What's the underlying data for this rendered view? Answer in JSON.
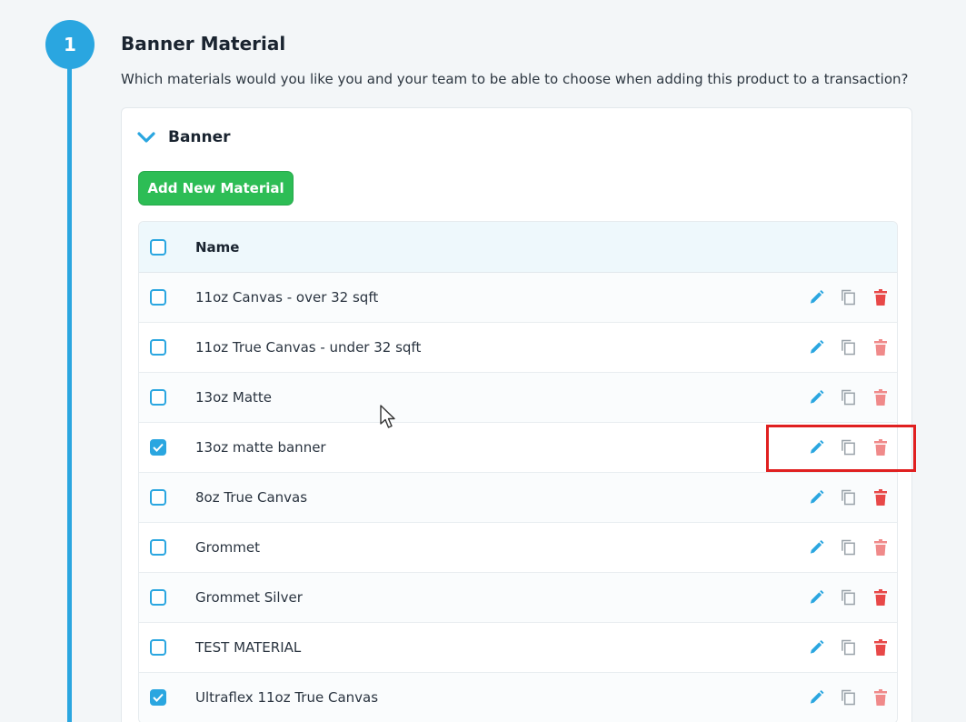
{
  "step": {
    "number": "1"
  },
  "section": {
    "title": "Banner Material",
    "description": "Which materials would you like you and your team to be able to choose when adding this product to a transaction?"
  },
  "group": {
    "label": "Banner",
    "expanded": true
  },
  "toolbar": {
    "add_label": "Add New Material"
  },
  "table": {
    "header": "Name",
    "rows": [
      {
        "name": "11oz Canvas - over 32 sqft",
        "checked": false
      },
      {
        "name": "11oz True Canvas - under 32 sqft",
        "checked": false
      },
      {
        "name": "13oz Matte",
        "checked": false
      },
      {
        "name": "13oz matte banner",
        "checked": true
      },
      {
        "name": "8oz True Canvas",
        "checked": false
      },
      {
        "name": "Grommet",
        "checked": false
      },
      {
        "name": "Grommet Silver",
        "checked": false
      },
      {
        "name": "TEST MATERIAL",
        "checked": false
      },
      {
        "name": "Ultraflex 11oz True Canvas",
        "checked": true
      }
    ],
    "actions": [
      "edit-icon",
      "copy-icon",
      "delete-icon"
    ]
  },
  "colors": {
    "accent": "#2aa6e0",
    "add_button": "#2dbd55",
    "delete": "#e84848",
    "highlight": "#e02020"
  }
}
